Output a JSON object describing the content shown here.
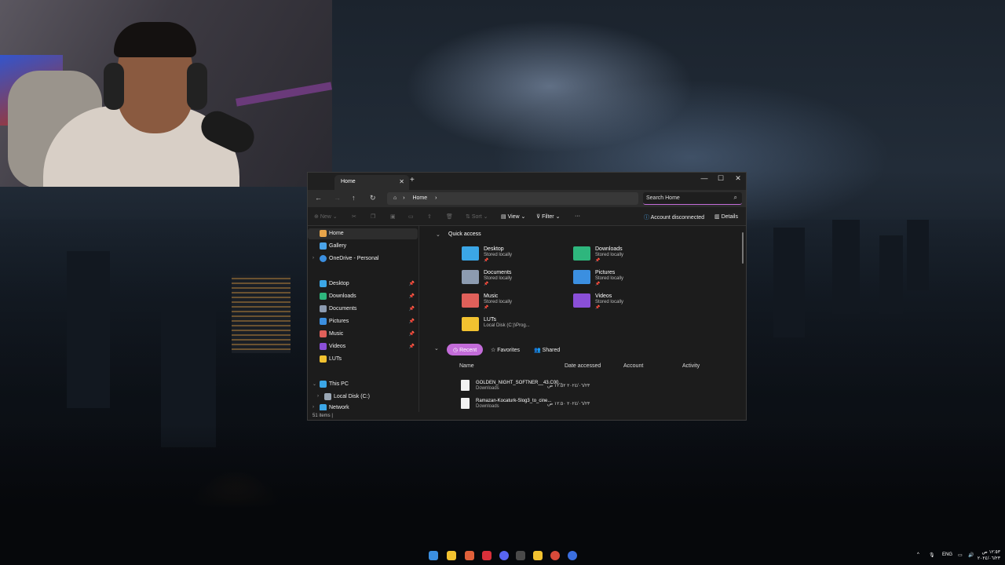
{
  "explorer": {
    "tab_title": "Home",
    "window_controls": {
      "minimize": "—",
      "maximize": "☐",
      "close": "✕"
    },
    "breadcrumb": {
      "home_label": "Home"
    },
    "search": {
      "placeholder": "Search Home"
    },
    "toolbar": {
      "new_label": "New",
      "sort_label": "Sort",
      "view_label": "View",
      "filter_label": "Filter",
      "more_label": "···",
      "account_label": "Account disconnected",
      "details_label": "Details"
    },
    "sidebar": {
      "items": [
        {
          "label": "Home",
          "icon": "home-icon",
          "color": "#e8a54a"
        },
        {
          "label": "Gallery",
          "icon": "gallery-icon",
          "color": "#4aa3e8"
        },
        {
          "label": "OneDrive - Personal",
          "icon": "cloud-icon",
          "color": "#3b8fe0"
        },
        {
          "label": "Desktop",
          "icon": "desktop-folder-icon",
          "color": "#3ba6e6"
        },
        {
          "label": "Downloads",
          "icon": "downloads-folder-icon",
          "color": "#2eb67d"
        },
        {
          "label": "Documents",
          "icon": "documents-folder-icon",
          "color": "#8c9bb0"
        },
        {
          "label": "Pictures",
          "icon": "pictures-folder-icon",
          "color": "#3b8fe0"
        },
        {
          "label": "Music",
          "icon": "music-folder-icon",
          "color": "#e0605a"
        },
        {
          "label": "Videos",
          "icon": "videos-folder-icon",
          "color": "#8a4fd8"
        },
        {
          "label": "LUTs",
          "icon": "folder-icon",
          "color": "#f2c230"
        },
        {
          "label": "This PC",
          "icon": "pc-icon",
          "color": "#3ba6e6"
        },
        {
          "label": "Local Disk (C:)",
          "icon": "disk-icon",
          "color": "#9aa7b5"
        },
        {
          "label": "Network",
          "icon": "network-icon",
          "color": "#3ba6e6"
        }
      ]
    },
    "quick_access": {
      "title": "Quick access",
      "items": [
        {
          "name": "Desktop",
          "sub": "Stored locally",
          "color": "#3ba6e6"
        },
        {
          "name": "Downloads",
          "sub": "Stored locally",
          "color": "#2eb67d"
        },
        {
          "name": "Documents",
          "sub": "Stored locally",
          "color": "#8c9bb0"
        },
        {
          "name": "Pictures",
          "sub": "Stored locally",
          "color": "#3b8fe0"
        },
        {
          "name": "Music",
          "sub": "Stored locally",
          "color": "#e0605a"
        },
        {
          "name": "Videos",
          "sub": "Stored locally",
          "color": "#8a4fd8"
        },
        {
          "name": "LUTs",
          "sub": "Local Disk (C:)\\Prog...",
          "color": "#f2c230"
        }
      ]
    },
    "recent_tabs": [
      "Recent",
      "Favorites",
      "Shared"
    ],
    "columns": [
      "Name",
      "Date accessed",
      "Account",
      "Activity"
    ],
    "files": [
      {
        "name": "GOLDEN_NIGHT_SOFTNER__43.C00...",
        "location": "Downloads",
        "date": "٢٠٢٤/٠٦/٢٣ ١٢:٥٢ ص"
      },
      {
        "name": "Ramazan-Kocaturk-Slog3_to_cine...",
        "location": "Downloads",
        "date": "٢٠٢٤/٠٦/٢٣ ١٢:٥٠ ص"
      }
    ],
    "status": "51 items  |"
  },
  "taskbar": {
    "tray_lang": "ENG",
    "clock_time": "١٢:٥٣ ص",
    "clock_date": "٢٠٢٤/٠٦/٢٣"
  }
}
